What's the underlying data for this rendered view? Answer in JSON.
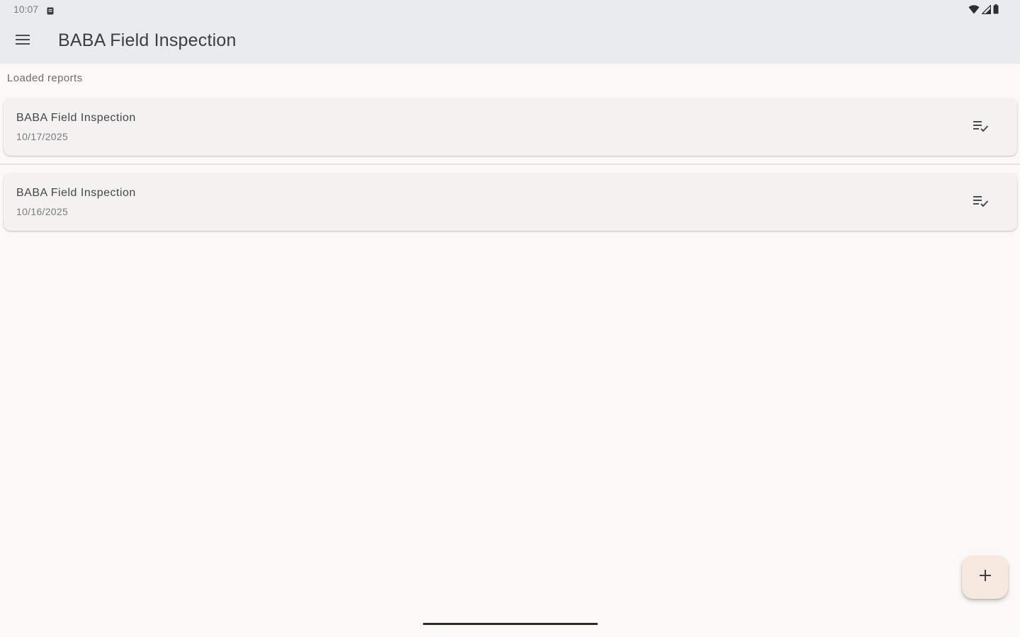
{
  "status_bar": {
    "time": "10:07",
    "icons": [
      "notification-icon",
      "wifi-icon",
      "signal-icon",
      "battery-icon"
    ]
  },
  "app_bar": {
    "menu_icon": "menu-icon",
    "title": "BABA Field Inspection"
  },
  "section": {
    "label": "Loaded reports"
  },
  "reports": [
    {
      "title": "BABA Field Inspection",
      "date": "10/17/2025",
      "action_icon": "checklist-icon"
    },
    {
      "title": "BABA Field Inspection",
      "date": "10/16/2025",
      "action_icon": "checklist-icon"
    }
  ],
  "fab": {
    "icon": "add-icon"
  },
  "colors": {
    "app_bar_bg": "#e9ebef",
    "page_bg": "#fcf8f6",
    "card_bg": "#f4f2f1",
    "fab_bg": "#f7e8e0"
  }
}
